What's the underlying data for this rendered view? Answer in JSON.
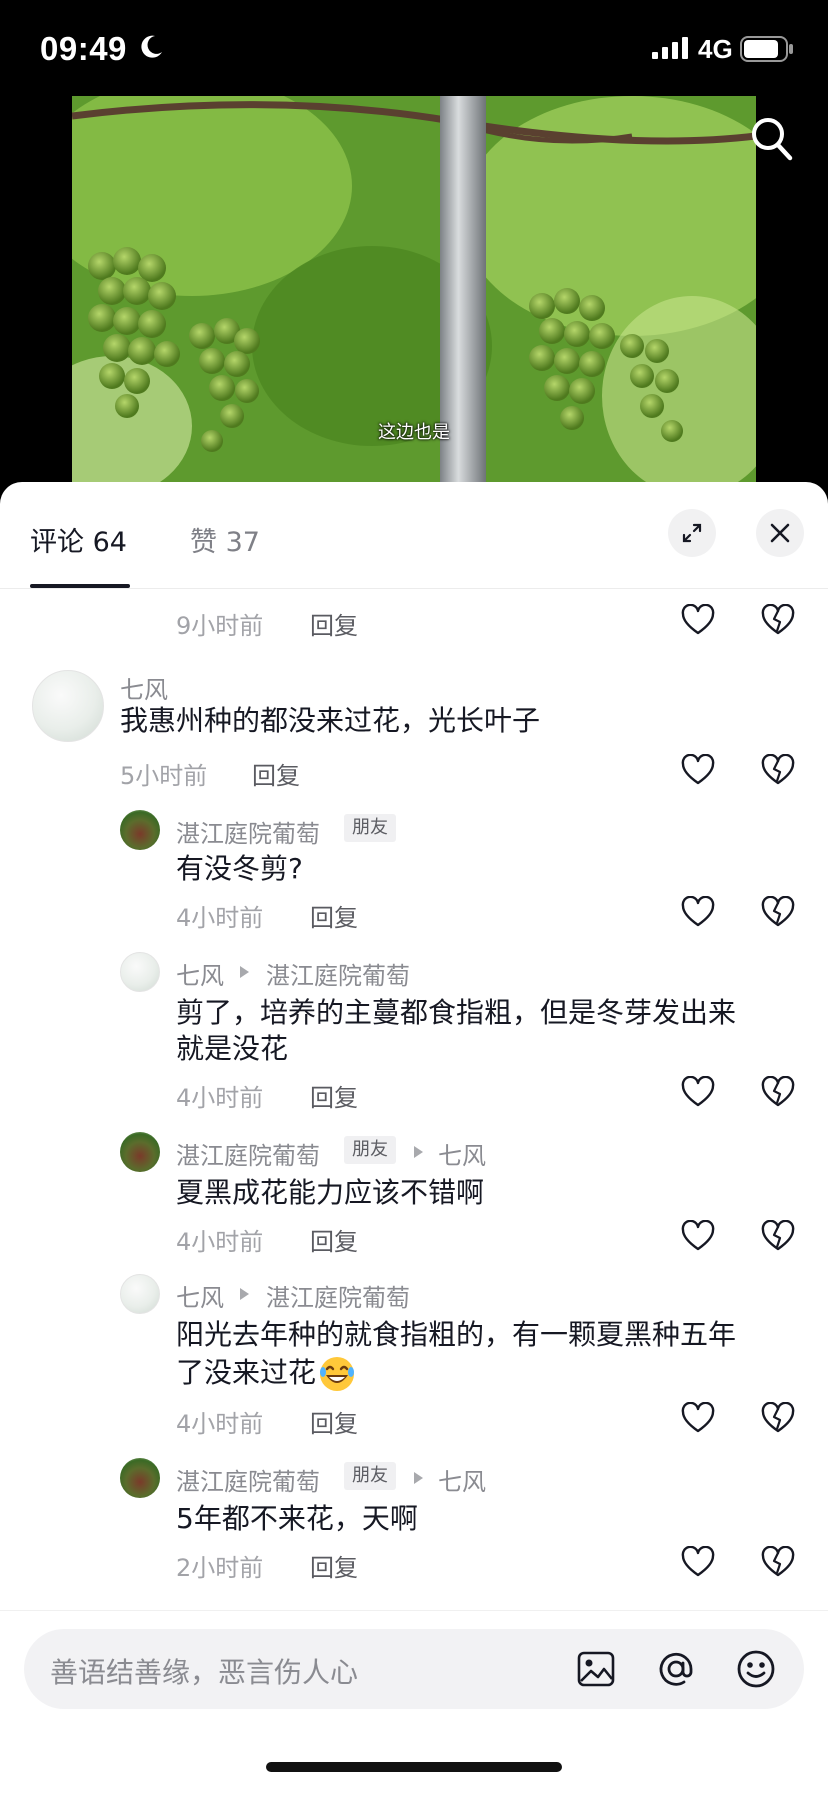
{
  "status_bar": {
    "time": "09:49",
    "network": "4G"
  },
  "video": {
    "subtitle": "这边也是"
  },
  "tabs": {
    "comments": "评论 64",
    "likes": "赞 37"
  },
  "comments": [
    {
      "id": "c0",
      "time": "9小时前",
      "reply_label": "回复"
    },
    {
      "id": "c1",
      "user": "七风",
      "content": "我惠州种的都没来过花，光长叶子",
      "time": "5小时前",
      "reply_label": "回复"
    },
    {
      "id": "c2",
      "user": "湛江庭院葡萄",
      "badge": "朋友",
      "content": "有没冬剪?",
      "time": "4小时前",
      "reply_label": "回复"
    },
    {
      "id": "c3",
      "user": "七风",
      "reply_to": "湛江庭院葡萄",
      "content_line1": "剪了，培养的主蔓都食指粗，但是冬芽发出来",
      "content_line2": "就是没花",
      "time": "4小时前",
      "reply_label": "回复"
    },
    {
      "id": "c4",
      "user": "湛江庭院葡萄",
      "badge": "朋友",
      "reply_to": "七风",
      "content": "夏黑成花能力应该不错啊",
      "time": "4小时前",
      "reply_label": "回复"
    },
    {
      "id": "c5",
      "user": "七风",
      "reply_to": "湛江庭院葡萄",
      "content_line1": "阳光去年种的就食指粗的，有一颗夏黑种五年",
      "content_line2": "了没来过花",
      "emoji": "rolling-laughing-emoji",
      "time": "4小时前",
      "reply_label": "回复"
    },
    {
      "id": "c6",
      "user": "湛江庭院葡萄",
      "badge": "朋友",
      "reply_to": "七风",
      "content": "5年都不来花，天啊",
      "time": "2小时前",
      "reply_label": "回复"
    }
  ],
  "input": {
    "placeholder": "善语结善缘，恶言伤人心"
  },
  "icons": {
    "search": "search-icon",
    "expand": "expand-icon",
    "close": "close-icon",
    "like": "heart-icon",
    "dislike": "broken-heart-icon",
    "image": "image-icon",
    "mention": "at-icon",
    "emoji": "smiley-icon"
  }
}
